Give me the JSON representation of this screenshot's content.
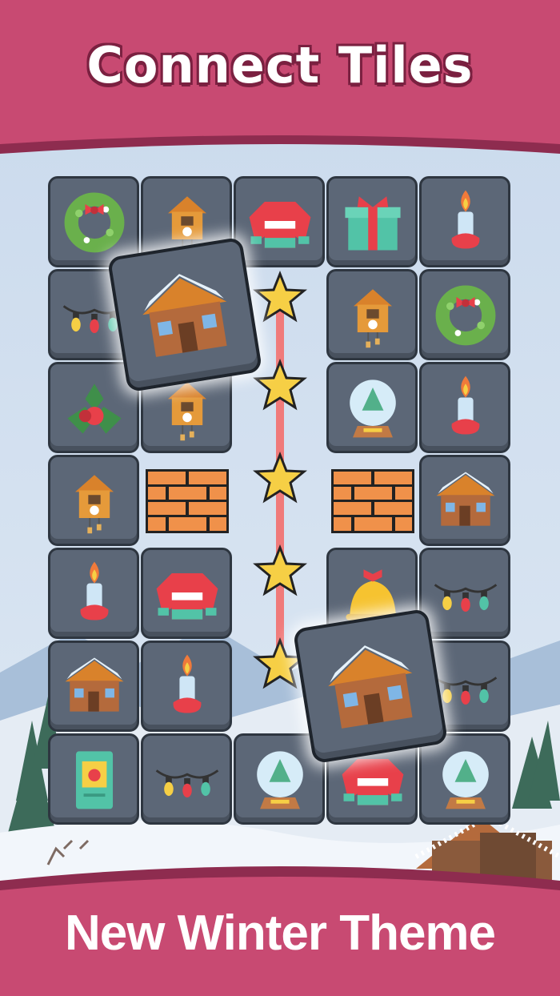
{
  "header": {
    "title": "Connect Tiles"
  },
  "footer": {
    "subtitle": "New Winter Theme"
  },
  "colors": {
    "banner": "#c84a72",
    "banner_dark": "#8e2c4f",
    "tile": "#5c6777",
    "path": "#f07a7a",
    "star": "#f6cf45"
  },
  "board": {
    "rows": [
      [
        "wreath-icon",
        "cuckoo-clock-icon",
        "sweater-icon",
        "gift-icon",
        "candle-icon"
      ],
      [
        "lights-icon",
        "",
        "",
        "cuckoo-clock-icon",
        "wreath-icon"
      ],
      [
        "holly-icon",
        "cuckoo-clock-icon",
        "",
        "snow-globe-icon",
        "candle-icon"
      ],
      [
        "cuckoo-clock-icon",
        "brick-wall-icon",
        "",
        "brick-wall-icon",
        "cabin-icon"
      ],
      [
        "candle-icon",
        "sweater-icon",
        "",
        "bell-icon",
        "lights-icon"
      ],
      [
        "cabin-icon",
        "candle-icon",
        "",
        "",
        "lights-icon"
      ],
      [
        "card-icon",
        "lights-icon",
        "snow-globe-icon",
        "sweater-icon",
        "snow-globe-icon"
      ]
    ],
    "selected": [
      "cabin-icon",
      "cabin-icon"
    ],
    "connection_path_stars": 5
  }
}
